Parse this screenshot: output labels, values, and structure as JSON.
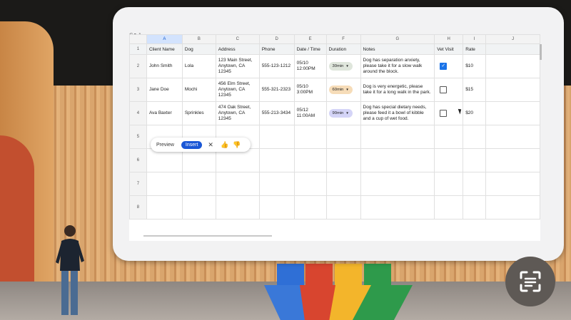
{
  "toolbar": {
    "glyph": "↶ ▾ ↗"
  },
  "columns": [
    "A",
    "B",
    "C",
    "D",
    "E",
    "F",
    "G",
    "H",
    "I",
    "J"
  ],
  "header": {
    "client": "Client Name",
    "dog": "Dog",
    "address": "Address",
    "phone": "Phone",
    "datetime": "Date / Time",
    "duration": "Duration",
    "notes": "Notes",
    "vet": "Vet Visit",
    "rate": "Rate"
  },
  "rows": [
    {
      "num": "2",
      "client": "John Smith",
      "dog": "Lola",
      "address": "123 Main Street, Anytown, CA 12345",
      "phone": "555-123-1212",
      "datetime": "05/10 12:00PM",
      "duration": "30min",
      "duration_color": "#dfe6dc",
      "notes": "Dog has separation anxiety, please take it for a slow walk around the block.",
      "vet": true,
      "rate": "$10"
    },
    {
      "num": "3",
      "client": "Jane Doe",
      "dog": "Mochi",
      "address": "456 Elm Street, Anytown, CA 12345",
      "phone": "555-321-2323",
      "datetime": "05/10 3:00PM",
      "duration": "60min",
      "duration_color": "#f6dcb8",
      "notes": "Dog is very energetic, please take it for a long walk in the park.",
      "vet": false,
      "rate": "$15"
    },
    {
      "num": "4",
      "client": "Ava Baxter",
      "dog": "Sprinkles",
      "address": "474 Oak Street, Anytown, CA 12345",
      "phone": "555-213-3434",
      "datetime": "05/12 11:00AM",
      "duration": "90min",
      "duration_color": "#d4d4f7",
      "notes": "Dog has special dietary needs, please feed it a bowl of kibble and a cup of wet food.",
      "vet": false,
      "rate": "$20"
    }
  ],
  "empty_rows": [
    "5",
    "6",
    "7",
    "8"
  ],
  "header_row_num": "1",
  "popup": {
    "preview": "Preview",
    "insert": "Insert",
    "close": "✕",
    "thumbs_up": "👍",
    "thumbs_down": "👎"
  },
  "colors": {
    "accent": "#1a57d6",
    "selected_header": "#d3e3fd"
  },
  "icons": [
    "undo-icon",
    "chevron-down-icon",
    "checkbox-icon",
    "caret-down-icon",
    "close-icon",
    "thumbs-up-icon",
    "thumbs-down-icon",
    "google-lens-icon"
  ]
}
